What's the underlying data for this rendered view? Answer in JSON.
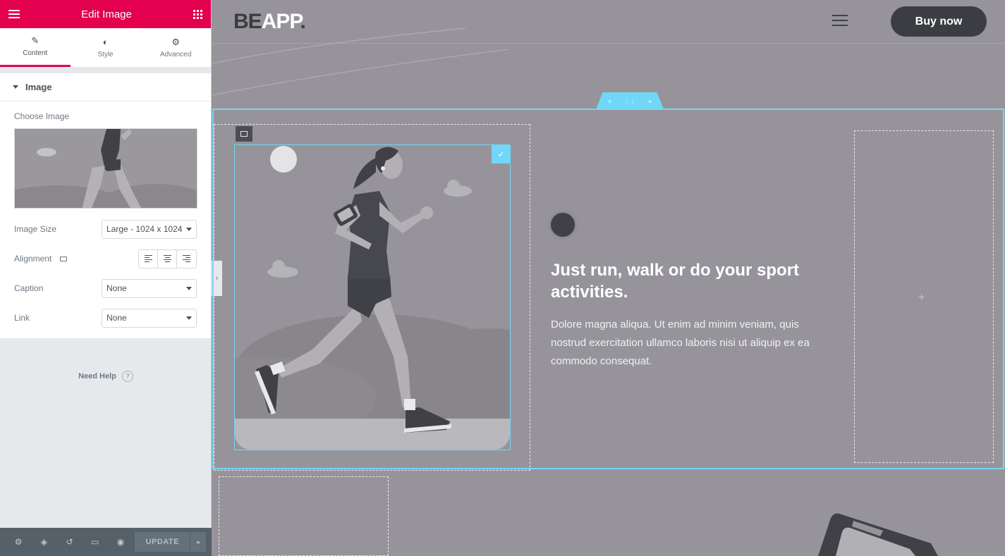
{
  "panel": {
    "title": "Edit Image",
    "tabs": [
      {
        "label": "Content",
        "icon": "pencil-icon"
      },
      {
        "label": "Style",
        "icon": "contrast-icon"
      },
      {
        "label": "Advanced",
        "icon": "gear-icon"
      }
    ],
    "section_title": "Image",
    "choose_image_label": "Choose Image",
    "image_size_label": "Image Size",
    "image_size_value": "Large - 1024 x 1024",
    "alignment_label": "Alignment",
    "caption_label": "Caption",
    "caption_value": "None",
    "link_label": "Link",
    "link_value": "None",
    "need_help": "Need Help",
    "need_help_icon": "?",
    "footer": {
      "update_label": "UPDATE"
    }
  },
  "site": {
    "logo_be": "BE",
    "logo_app": "APP",
    "logo_dot": ".",
    "buy_label": "Buy now",
    "heading": "Just run, walk or do your sport activities.",
    "body": "Dolore magna aliqua. Ut enim ad minim veniam, quis nostrud exercitation ullamco laboris nisi ut aliquip ex ea commodo consequat."
  },
  "colors": {
    "accent": "#e2004f",
    "selection": "#71d7f7",
    "overlay": "#96949a"
  }
}
